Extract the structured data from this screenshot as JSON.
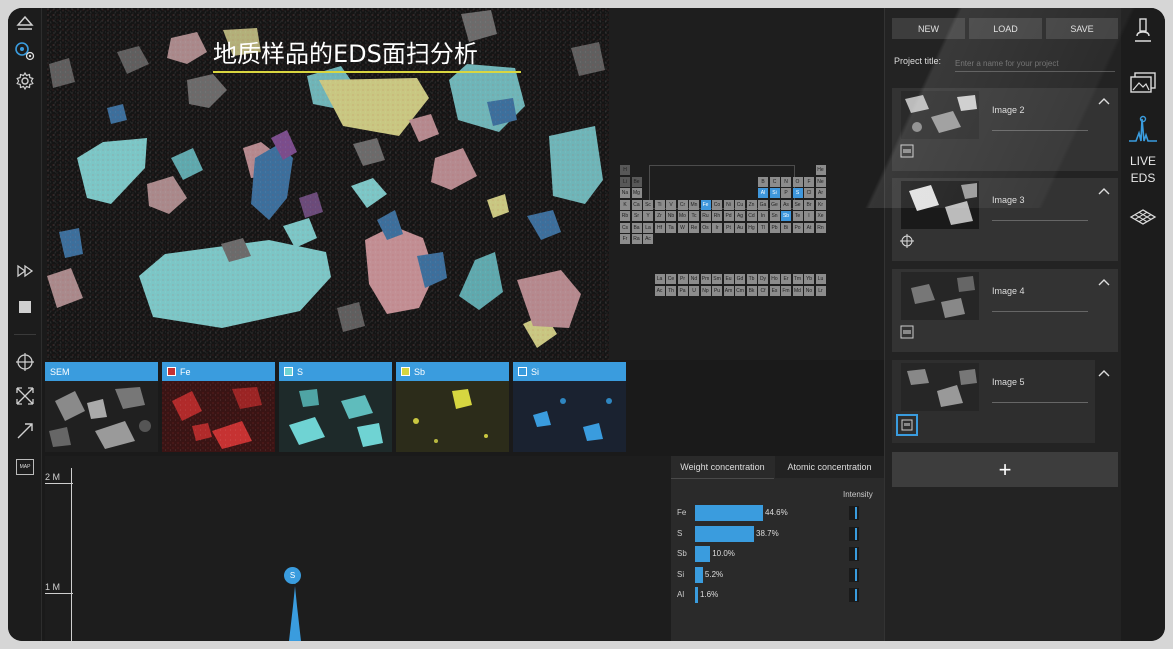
{
  "title": "地质样品的EDS面扫分析",
  "colors": {
    "accent": "#3a9cde",
    "title_underline": "#d9d640",
    "fe": "#c63232",
    "s": "#6fd3d3",
    "sb": "#d6d640",
    "si": "#3a9cde"
  },
  "left_toolbar": {
    "icons": [
      "eject-icon",
      "acquire-target-icon",
      "settings-gear-icon",
      "fast-forward-icon",
      "stop-icon",
      "crosshair-icon",
      "fit-expand-icon",
      "line-arrow-icon",
      "map-icon"
    ],
    "map_label": "MAP"
  },
  "periodic_table": {
    "highlighted": [
      "Fe",
      "Al",
      "Si",
      "S",
      "Sb"
    ],
    "visible_symbols": [
      "K",
      "Ca",
      "Fe",
      "Al",
      "Si",
      "P",
      "S",
      "Sb",
      "Te",
      "I",
      "Cs",
      "Ba",
      "Ra",
      "Ac",
      "La",
      "Ce"
    ]
  },
  "thumbnails": [
    {
      "label": "SEM",
      "swatch": ""
    },
    {
      "label": "Fe",
      "swatch": "#c63232"
    },
    {
      "label": "S",
      "swatch": "#6fd3d3"
    },
    {
      "label": "Sb",
      "swatch": "#d6d640"
    },
    {
      "label": "Si",
      "swatch": "#3a9cde"
    }
  ],
  "spectrum": {
    "y_ticks": [
      "2 M",
      "1 M"
    ],
    "peak_label": "S"
  },
  "concentration": {
    "tabs": [
      "Weight concentration",
      "Atomic concentration"
    ],
    "intensity_label": "Intensity",
    "rows": [
      {
        "element": "Fe",
        "value": 44.6,
        "label": "44.6%"
      },
      {
        "element": "S",
        "value": 38.7,
        "label": "38.7%"
      },
      {
        "element": "Sb",
        "value": 10.0,
        "label": "10.0%"
      },
      {
        "element": "Si",
        "value": 5.2,
        "label": "5.2%"
      },
      {
        "element": "Al",
        "value": 1.6,
        "label": "1.6%"
      }
    ]
  },
  "project": {
    "buttons": {
      "new": "NEW",
      "load": "LOAD",
      "save": "SAVE"
    },
    "title_label": "Project title:",
    "title_placeholder": "Enter a name for your project",
    "cards": [
      {
        "name": "Image 2",
        "icon": "map-icon"
      },
      {
        "name": "Image 3",
        "icon": "crosshair-icon"
      },
      {
        "name": "Image 4",
        "icon": "map-icon"
      },
      {
        "name": "Image 5",
        "icon": "map-icon"
      }
    ],
    "add_label": "+"
  },
  "right_toolbar": {
    "icons": [
      "microscope-icon",
      "image-gallery-icon",
      "live-eds-spectrum-icon",
      "surface-map-icon"
    ],
    "live_eds_label_1": "LIVE",
    "live_eds_label_2": "EDS"
  }
}
